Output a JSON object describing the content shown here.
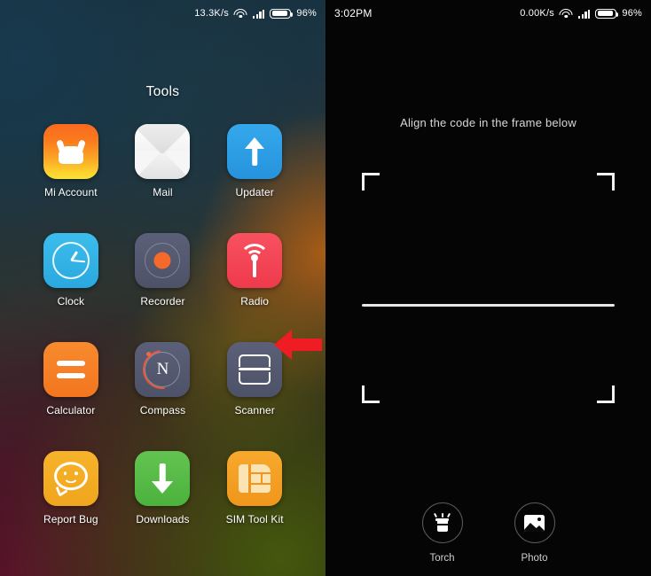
{
  "left_phone": {
    "status_bar": {
      "net_speed": "13.3K/s",
      "battery_pct": "96%",
      "wifi_icon": "wifi-icon",
      "signal_icon": "signal-bars-icon",
      "battery_icon": "battery-icon"
    },
    "folder_title": "Tools",
    "apps": [
      {
        "label": "Mi Account",
        "icon": "mi-account-icon",
        "color": "#f9821e"
      },
      {
        "label": "Mail",
        "icon": "mail-envelope-icon",
        "color": "#f2f2f2"
      },
      {
        "label": "Updater",
        "icon": "arrow-up-icon",
        "color": "#2f9fe6"
      },
      {
        "label": "Clock",
        "icon": "clock-icon",
        "color": "#33b2e6"
      },
      {
        "label": "Recorder",
        "icon": "record-dot-icon",
        "color": "#545970"
      },
      {
        "label": "Radio",
        "icon": "radio-tower-icon",
        "color": "#f3475a"
      },
      {
        "label": "Calculator",
        "icon": "equals-icon",
        "color": "#f5801f"
      },
      {
        "label": "Compass",
        "icon": "compass-north-icon",
        "color": "#545970"
      },
      {
        "label": "Scanner",
        "icon": "scanner-frame-icon",
        "color": "#545970"
      },
      {
        "label": "Report Bug",
        "icon": "smiley-bubble-icon",
        "color": "#f3ab22"
      },
      {
        "label": "Downloads",
        "icon": "arrow-down-icon",
        "color": "#55ba46"
      },
      {
        "label": "SIM Tool Kit",
        "icon": "sim-card-icon",
        "color": "#f39e22"
      }
    ],
    "annotation": {
      "arrow": "red-left-arrow-marker",
      "points_at": "Scanner",
      "color": "#ef1c24"
    }
  },
  "right_phone": {
    "status_bar": {
      "clock": "3:02PM",
      "net_speed": "0.00K/s",
      "battery_pct": "96%",
      "wifi_icon": "wifi-icon",
      "signal_icon": "signal-bars-icon",
      "battery_icon": "battery-icon"
    },
    "hint_text": "Align the code in the frame below",
    "scan_frame": {
      "corners": "four-corner-brackets",
      "scan_line": "horizontal-scan-line"
    },
    "toolbar": [
      {
        "label": "Torch",
        "icon": "torch-icon"
      },
      {
        "label": "Photo",
        "icon": "photo-gallery-icon"
      }
    ],
    "annotation": {
      "arrow": "red-down-arrow-marker",
      "points_at": "Photo",
      "color": "#ef1c24"
    }
  }
}
